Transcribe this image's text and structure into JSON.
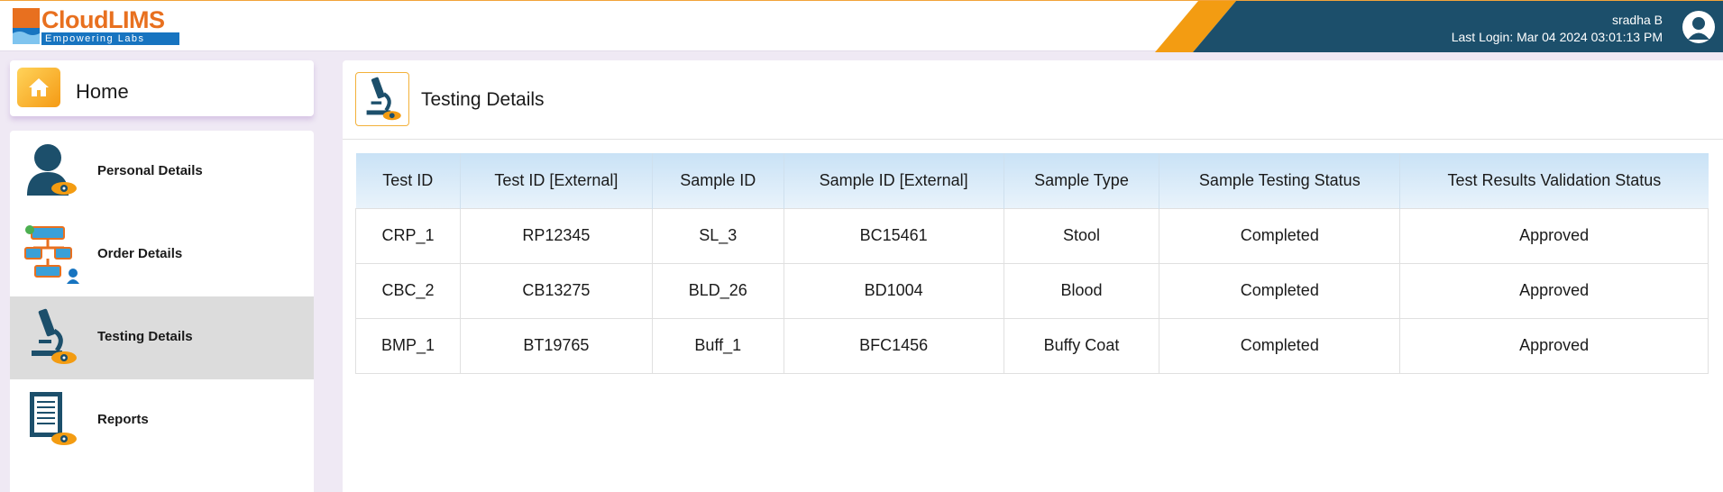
{
  "brand": {
    "name": "CloudLIMS",
    "tagline": "Empowering Labs",
    "colors": {
      "orange": "#e8701f",
      "blue": "#1774c0",
      "band": "#1c4f6b",
      "accent": "#f39c12"
    }
  },
  "user": {
    "name": "sradha B",
    "last_login": "Last Login: Mar 04 2024 03:01:13 PM",
    "avatar_icon": "user-avatar-icon"
  },
  "home": {
    "label": "Home",
    "icon": "home-icon"
  },
  "sidebar": {
    "items": [
      {
        "label": "Personal Details",
        "icon": "person-icon",
        "active": false
      },
      {
        "label": "Order Details",
        "icon": "workflow-icon",
        "active": false
      },
      {
        "label": "Testing Details",
        "icon": "microscope-icon",
        "active": true
      },
      {
        "label": "Reports",
        "icon": "report-document-icon",
        "active": false
      }
    ]
  },
  "main": {
    "title": "Testing Details",
    "icon": "microscope-icon",
    "table": {
      "columns": [
        "Test ID",
        "Test ID [External]",
        "Sample ID",
        "Sample ID [External]",
        "Sample Type",
        "Sample Testing Status",
        "Test Results Validation Status"
      ],
      "rows": [
        [
          "CRP_1",
          "RP12345",
          "SL_3",
          "BC15461",
          "Stool",
          "Completed",
          "Approved"
        ],
        [
          "CBC_2",
          "CB13275",
          "BLD_26",
          "BD1004",
          "Blood",
          "Completed",
          "Approved"
        ],
        [
          "BMP_1",
          "BT19765",
          "Buff_1",
          "BFC1456",
          "Buffy Coat",
          "Completed",
          "Approved"
        ]
      ]
    }
  }
}
